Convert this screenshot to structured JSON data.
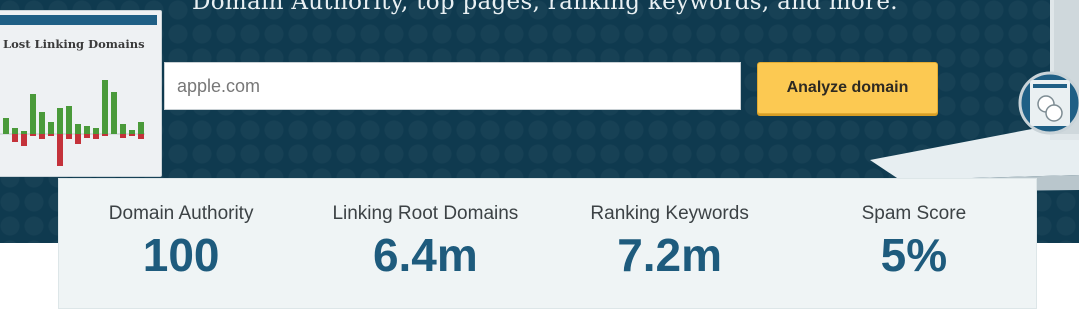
{
  "hero": {
    "subtitle": "Domain Authority, top pages, ranking keywords, and more."
  },
  "chart_panel": {
    "title": "Lost Linking Domains",
    "colors": {
      "up": "#4a9a3a",
      "down": "#c4323a",
      "topbar": "#1f5f85"
    },
    "bars": [
      {
        "up": 16,
        "down": 0
      },
      {
        "up": 6,
        "down": 8
      },
      {
        "up": 3,
        "down": 12
      },
      {
        "up": 40,
        "down": 2
      },
      {
        "up": 22,
        "down": 5
      },
      {
        "up": 12,
        "down": 2
      },
      {
        "up": 26,
        "down": 32
      },
      {
        "up": 28,
        "down": 5
      },
      {
        "up": 10,
        "down": 10
      },
      {
        "up": 8,
        "down": 4
      },
      {
        "up": 6,
        "down": 5
      },
      {
        "up": 54,
        "down": 2
      },
      {
        "up": 42,
        "down": 0
      },
      {
        "up": 10,
        "down": 4
      },
      {
        "up": 4,
        "down": 2
      },
      {
        "up": 12,
        "down": 5
      }
    ]
  },
  "search": {
    "placeholder": "apple.com",
    "button_label": "Analyze domain",
    "button_color": "#fcc952"
  },
  "metrics": [
    {
      "label": "Domain Authority",
      "value": "100"
    },
    {
      "label": "Linking Root Domains",
      "value": "6.4m"
    },
    {
      "label": "Ranking Keywords",
      "value": "7.2m"
    },
    {
      "label": "Spam Score",
      "value": "5%"
    }
  ],
  "colors": {
    "hero_bg": "#0f3a4f",
    "metric_value": "#1e5b7d",
    "metrics_bg": "#eff4f5"
  }
}
